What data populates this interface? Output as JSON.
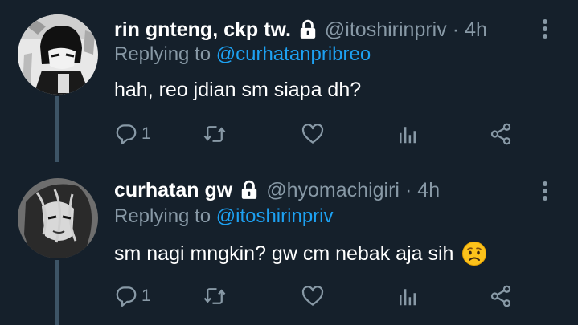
{
  "tweets": [
    {
      "display_name": "rin gnteng, ckp tw.",
      "handle": "@itoshirinpriv",
      "separator": "·",
      "time": "4h",
      "replying_prefix": "Replying to",
      "replying_to": "@curhatanpribreo",
      "text": "hah, reo jdian sm siapa dh?",
      "reply_count": "1",
      "avatar": "manga-boy-avatar",
      "protected": true
    },
    {
      "display_name": "curhatan gw",
      "handle": "@hyomachigiri",
      "separator": "·",
      "time": "4h",
      "replying_prefix": "Replying to",
      "replying_to": "@itoshirinpriv",
      "text": "sm nagi mngkin? gw cm nebak aja sih",
      "emoji": "worried-face-emoji",
      "reply_count": "1",
      "avatar": "manga-girl-avatar",
      "protected": true
    }
  ],
  "icons": {
    "lock": "lock-icon",
    "reply": "reply-icon",
    "retweet": "retweet-icon",
    "like": "heart-icon",
    "stats": "stats-icon",
    "share": "share-icon",
    "more": "more-vertical-icon"
  },
  "colors": {
    "background": "#15202b",
    "text_primary": "#ffffff",
    "text_secondary": "#8899a6",
    "link": "#1da1f2",
    "thread_line": "#3d5466"
  }
}
